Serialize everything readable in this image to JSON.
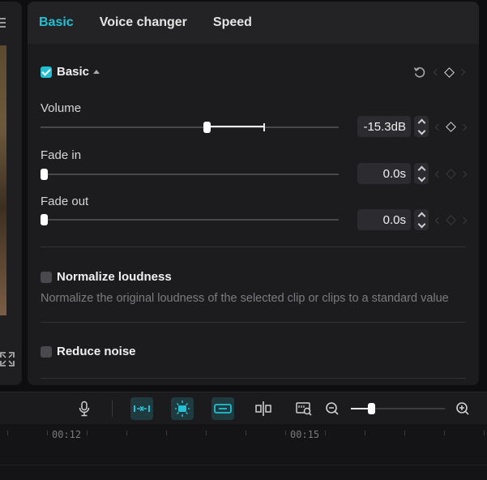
{
  "tabs": [
    {
      "label": "Basic",
      "active": true
    },
    {
      "label": "Voice changer",
      "active": false
    },
    {
      "label": "Speed",
      "active": false
    }
  ],
  "basic_section": {
    "title": "Basic",
    "checked": true,
    "expanded": true
  },
  "params": {
    "volume": {
      "label": "Volume",
      "value": "-15.3dB",
      "slider_fraction": 0.56
    },
    "fade_in": {
      "label": "Fade in",
      "value": "0.0s",
      "slider_fraction": 0.0
    },
    "fade_out": {
      "label": "Fade out",
      "value": "0.0s",
      "slider_fraction": 0.0
    }
  },
  "normalize": {
    "title": "Normalize loudness",
    "checked": false,
    "description": "Normalize the original loudness of the selected clip or clips to a standard value"
  },
  "reduce_noise": {
    "title": "Reduce noise",
    "checked": false
  },
  "toolbar": {
    "icons": [
      "microphone-icon",
      "link-audio-icon",
      "auto-snap-icon",
      "link-clips-icon",
      "split-icon",
      "preview-zoom-icon",
      "zoom-out-icon",
      "zoom-in-icon"
    ],
    "zoom_fraction": 0.2
  },
  "ruler": {
    "labels": [
      "00:12",
      "00:15"
    ]
  },
  "colors": {
    "accent": "#24c0d4",
    "panel_bg": "#1c1c1f",
    "tab_bar_bg": "#232326"
  }
}
